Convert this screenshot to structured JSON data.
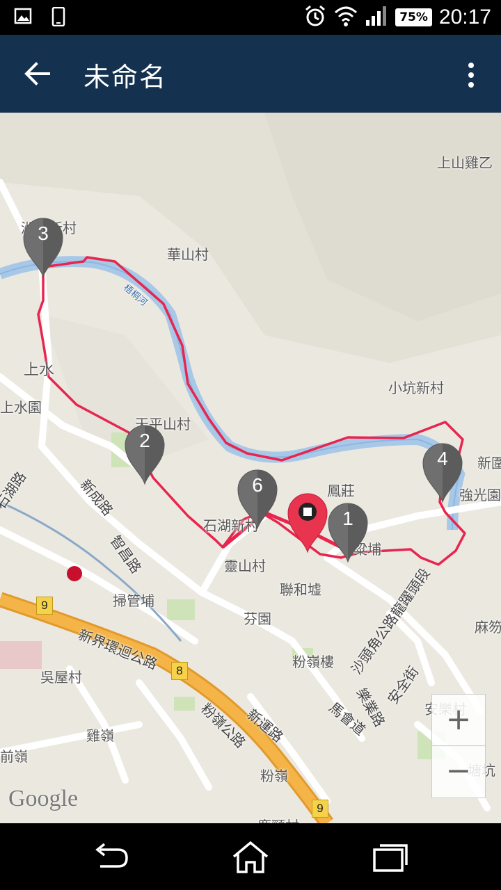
{
  "status_bar": {
    "time": "20:17",
    "battery": "75%",
    "icons": [
      "image-icon",
      "phone-icon",
      "alarm-icon",
      "wifi-icon",
      "signal-icon",
      "battery-icon"
    ]
  },
  "app_bar": {
    "title": "未命名",
    "back_icon": "arrow-back-icon",
    "menu_icon": "more-vert-icon"
  },
  "map": {
    "labels": {
      "shang_shan_ji": "上山雞乙",
      "village_top": "洲頭新村",
      "hua_shan": "華山村",
      "river": "梧桐河",
      "sheung_shui": "上水",
      "sheung_shui_wai": "上水園",
      "tin_ping": "天平山村",
      "xiao_keng": "小坑新村",
      "xin_wei": "新圍",
      "keung_kwong": "強光園",
      "shek_wu": "石湖新村",
      "ling_shan": "靈山村",
      "luen_wo": "聯和墟",
      "fen_yuen": "芬園",
      "fanling_lau": "粉嶺樓",
      "sou_gun": "掃管埔",
      "ng_uk": "吳屋村",
      "kai_ling": "雞嶺",
      "chin_ling": "前嶺",
      "fanling": "粉嶺",
      "ma_fat": "麻笏",
      "on_lok": "安樂村",
      "tong_hang": "塘坑",
      "wo_hop_shek": "鳳莊",
      "lung_yeuk": "粱埔",
      "gaan_tit": "鹿頸村",
      "road_san_shing": "新成路",
      "road_tsz_cheong": "智昌路",
      "road_shek_wu": "石湖路",
      "road_ring": "新界環迴公路",
      "road_fanling_hwy": "粉嶺公路",
      "road_san_wan": "新運路",
      "road_ma_wui": "馬會道",
      "road_lok_yip": "樂業路",
      "road_on_kui": "安全街",
      "road_sha_tau_kok": "沙頭角公路龍躍頭段"
    },
    "shields": [
      "9",
      "8",
      "9"
    ],
    "markers": [
      "1",
      "2",
      "3",
      "4",
      "6"
    ],
    "current_marker_icon": "stop-icon",
    "attribution": "Google",
    "zoom_in": "+",
    "zoom_out": "−",
    "colors": {
      "route": "#e8254e",
      "river": "#a8c8e8",
      "highway": "#f0a030",
      "marker_gray": "#6f6f6f",
      "marker_current": "#e8344e"
    }
  },
  "nav_bar": {
    "icons": [
      "back-nav-icon",
      "home-icon",
      "recents-icon"
    ]
  }
}
